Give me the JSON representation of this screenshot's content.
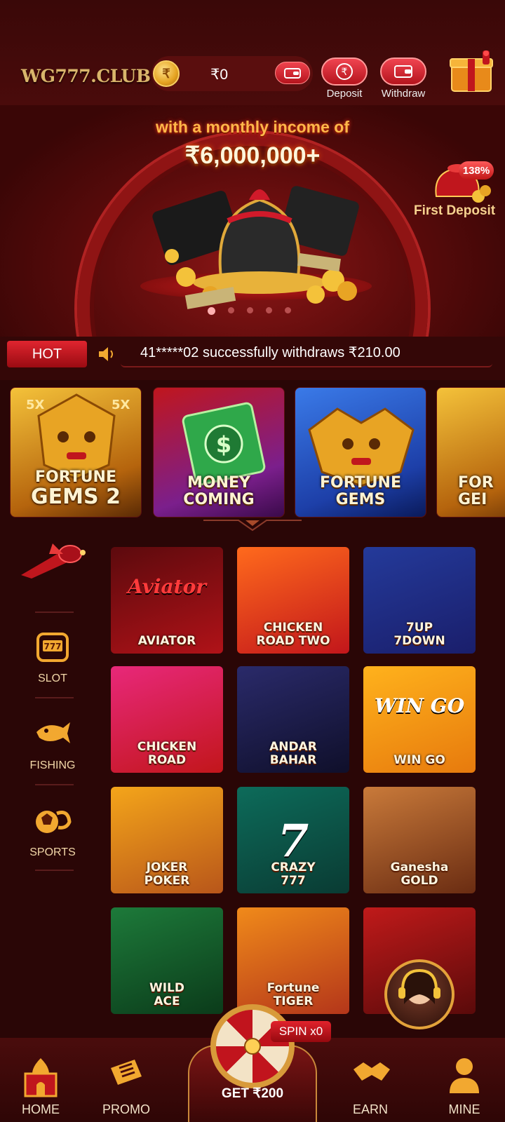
{
  "header": {
    "logo": "WG777.CLUB",
    "balance": "₹0",
    "coin_symbol": "₹",
    "deposit_label": "Deposit",
    "withdraw_label": "Withdraw",
    "deposit_icon_text": "₹"
  },
  "banner": {
    "line1": "with a monthly income of",
    "line2": "₹6,000,000+",
    "first_deposit_label": "First Deposit",
    "first_deposit_badge": "138%",
    "slide_count": 5,
    "active_slide": 1
  },
  "marquee": {
    "hot_label": "HOT",
    "text": "41*****02 successfully withdraws ₹210.00"
  },
  "hot_games": [
    {
      "title_line1": "FORTUNE",
      "title_line2": "GEMS 2",
      "bg": "#d79a1c"
    },
    {
      "title_line1": "MONEY",
      "title_line2": "COMING",
      "bg": "#7b1f8c"
    },
    {
      "title_line1": "FORTUNE",
      "title_line2": "GEMS",
      "bg": "#2b6fd4"
    },
    {
      "title_line1": "FOR",
      "title_line2": "GEI",
      "bg": "#d08a1a"
    }
  ],
  "categories": [
    {
      "label": "",
      "icon": "aviator-plane-icon"
    },
    {
      "label": "SLOT",
      "icon": "slot-machine-icon"
    },
    {
      "label": "FISHING",
      "icon": "fish-icon"
    },
    {
      "label": "SPORTS",
      "icon": "sports-ball-icon"
    }
  ],
  "games": [
    {
      "title_line1": "AVIATOR",
      "title_line2": "",
      "art": "Aviator",
      "bg1": "#5c0a0d",
      "bg2": "#b01218"
    },
    {
      "title_line1": "CHICKEN",
      "title_line2": "ROAD TWO",
      "art": "",
      "bg1": "#ff6a1c",
      "bg2": "#c2161b"
    },
    {
      "title_line1": "7UP",
      "title_line2": "7DOWN",
      "art": "",
      "bg1": "#243a9a",
      "bg2": "#1a1e6b"
    },
    {
      "title_line1": "CHICKEN",
      "title_line2": "ROAD",
      "art": "",
      "bg1": "#e8287a",
      "bg2": "#c2161b"
    },
    {
      "title_line1": "ANDAR",
      "title_line2": "BAHAR",
      "art": "",
      "bg1": "#2a2a6a",
      "bg2": "#0f0f2a"
    },
    {
      "title_line1": "WIN GO",
      "title_line2": "",
      "art": "WIN GO",
      "bg1": "#ffb21c",
      "bg2": "#e77a0d"
    },
    {
      "title_line1": "JOKER",
      "title_line2": "POKER",
      "art": "",
      "bg1": "#f4a51a",
      "bg2": "#b8561a"
    },
    {
      "title_line1": "CRAZY",
      "title_line2": "777",
      "art": "7",
      "bg1": "#0d6b5a",
      "bg2": "#0a3b33"
    },
    {
      "title_line1": "Ganesha",
      "title_line2": "GOLD",
      "art": "",
      "bg1": "#c97a3a",
      "bg2": "#6a2c12"
    },
    {
      "title_line1": "WILD",
      "title_line2": "ACE",
      "art": "",
      "bg1": "#1d7a3a",
      "bg2": "#0b3b1a"
    },
    {
      "title_line1": "Fortune",
      "title_line2": "TIGER",
      "art": "",
      "bg1": "#f08a1a",
      "bg2": "#b4361a"
    },
    {
      "title_line1": "",
      "title_line2": "",
      "art": "",
      "bg1": "#c01a1a",
      "bg2": "#5a0a0a"
    }
  ],
  "spin": {
    "badge": "SPIN x0",
    "cta": "GET ₹200"
  },
  "nav": [
    {
      "label": "HOME",
      "icon": "palace-icon"
    },
    {
      "label": "PROMO",
      "icon": "ticket-icon"
    },
    {
      "label": "EARN",
      "icon": "handshake-icon"
    },
    {
      "label": "MINE",
      "icon": "user-icon"
    }
  ],
  "colors": {
    "bg": "#2a0606",
    "accent_red": "#e0252f",
    "gold": "#d9b56b"
  }
}
